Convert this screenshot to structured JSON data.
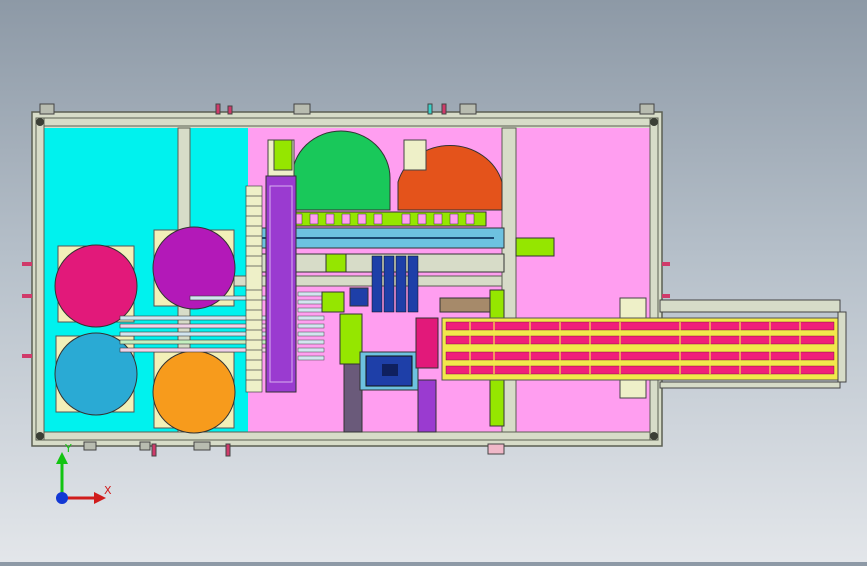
{
  "viewport": {
    "background_top": "#8d99a6",
    "background_bottom": "#e3e6ea"
  },
  "colors": {
    "frame": "#d7dcc8",
    "frame_edge": "#5b5f52",
    "cyan_zone": "#00f2ee",
    "pink_zone": "#ff9ef0",
    "green_drum": "#19c85a",
    "orange_drum": "#e4531b",
    "magenta_reel": "#e2197a",
    "purple_reel": "#b319b8",
    "blue_reel": "#2aaad4",
    "yellow_reel": "#f79b1c",
    "conveyor_belt": "#f2e84b",
    "conveyor_cells": "#f0207a",
    "gantry": "#6dc2e0",
    "vertical_actuator": "#9a3bd0",
    "lime_parts": "#95e600",
    "navy_housing": "#1e3fa8"
  },
  "axis_triad": {
    "x_label": "X",
    "y_label": "Y",
    "x_color": "#d01c1c",
    "y_color": "#12c412",
    "z_color": "#1238d4",
    "icon": "coordinate-triad-icon"
  }
}
